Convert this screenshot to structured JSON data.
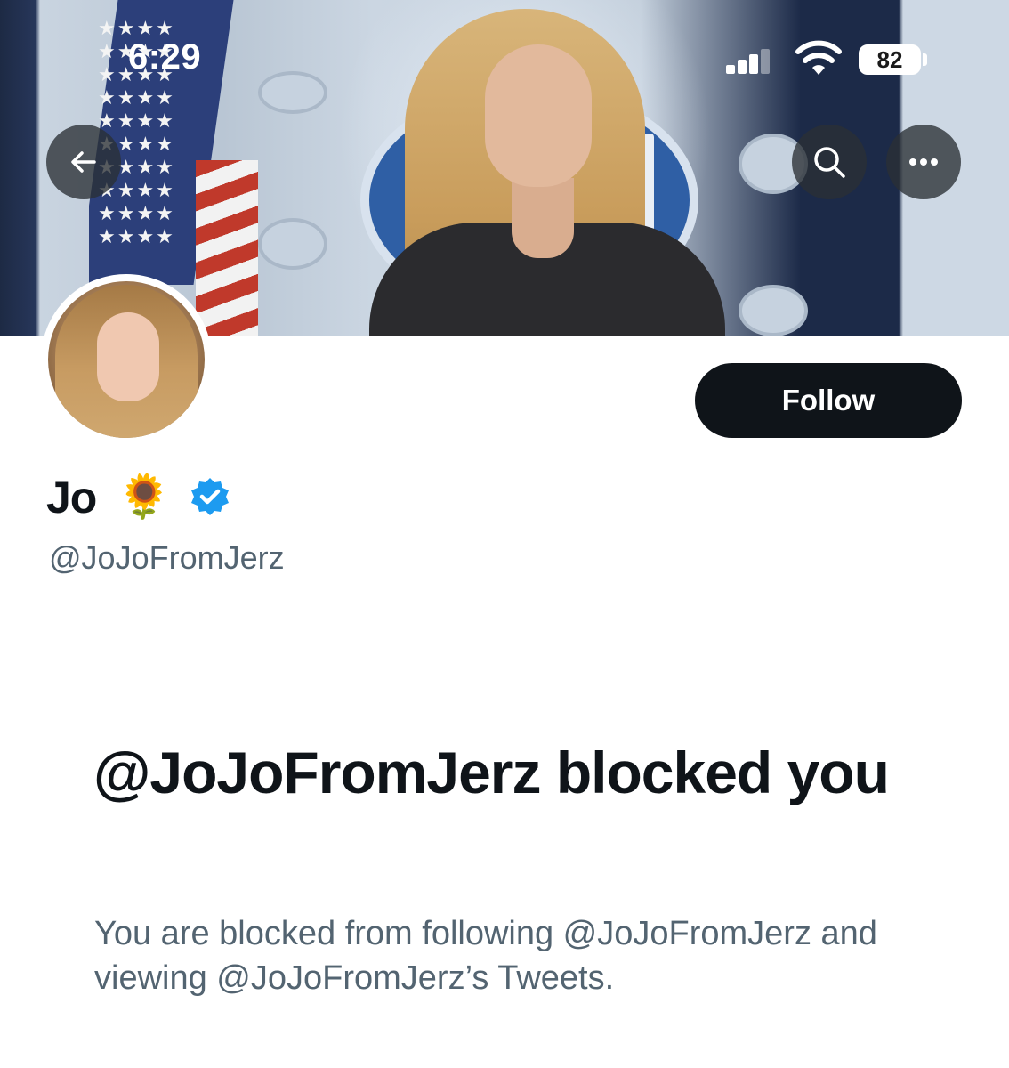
{
  "status_bar": {
    "time": "6:29",
    "battery": "82"
  },
  "profile": {
    "display_name": "Jo",
    "name_emoji": "🌻",
    "handle": "@JoJoFromJerz",
    "follow_label": "Follow"
  },
  "blocked": {
    "title": "@JoJoFromJerz blocked you",
    "description": "You are blocked from following @JoJoFromJerz and viewing @JoJoFromJerz’s Tweets."
  },
  "colors": {
    "primary_text": "#0f1419",
    "secondary_text": "#536471",
    "verified_blue": "#1d9bf0",
    "button_dark": "#0f1419"
  },
  "icons": [
    "back-arrow-icon",
    "search-icon",
    "more-icon",
    "verified-badge-icon",
    "signal-icon",
    "wifi-icon",
    "battery-icon"
  ]
}
